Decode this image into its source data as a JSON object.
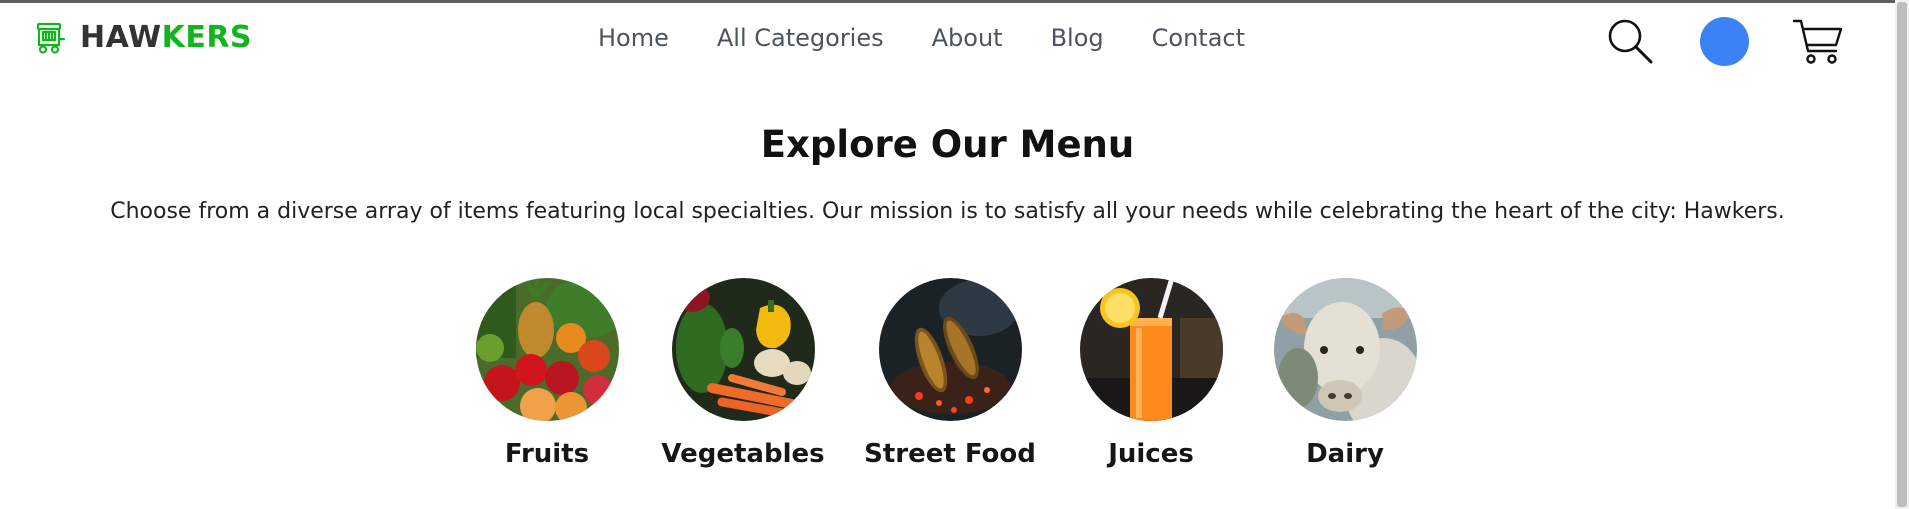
{
  "brand": {
    "name_part1": "HAW",
    "name_part2": "KERS",
    "icon": "food-cart-icon",
    "accent_color": "#13b51f"
  },
  "nav": {
    "items": [
      {
        "label": "Home"
      },
      {
        "label": "All Categories"
      },
      {
        "label": "About"
      },
      {
        "label": "Blog"
      },
      {
        "label": "Contact"
      }
    ]
  },
  "header_actions": {
    "search_icon": "search-icon",
    "avatar_color": "#3b82f6",
    "cart_icon": "cart-icon"
  },
  "main": {
    "title": "Explore Our Menu",
    "subtitle": "Choose from a diverse array of items featuring local specialties. Our mission is to satisfy all your needs while celebrating the heart of the city: Hawkers.",
    "categories": [
      {
        "label": "Fruits"
      },
      {
        "label": "Vegetables"
      },
      {
        "label": "Street Food"
      },
      {
        "label": "Juices"
      },
      {
        "label": "Dairy"
      }
    ]
  }
}
